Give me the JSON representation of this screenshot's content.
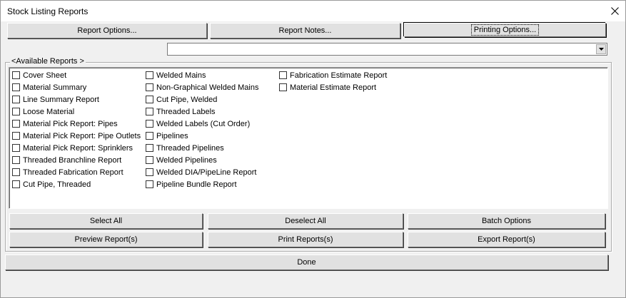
{
  "window": {
    "title": "Stock Listing Reports",
    "close_glyph": "close-icon"
  },
  "top_buttons": {
    "report_options": "Report Options...",
    "report_notes": "Report Notes...",
    "printing_options": "Printing Options..."
  },
  "combo": {
    "value": ""
  },
  "group": {
    "legend": "<Available Reports >"
  },
  "reports": {
    "col1": [
      {
        "label": "Cover Sheet",
        "checked": false
      },
      {
        "label": "Material Summary",
        "checked": false
      },
      {
        "label": "Line Summary Report",
        "checked": false
      },
      {
        "label": "Loose Material",
        "checked": false
      },
      {
        "label": "Material Pick Report: Pipes",
        "checked": false
      },
      {
        "label": "Material Pick Report: Pipe Outlets",
        "checked": false
      },
      {
        "label": "Material Pick Report: Sprinklers",
        "checked": false
      },
      {
        "label": "Threaded Branchline Report",
        "checked": false
      },
      {
        "label": "Threaded Fabrication Report",
        "checked": false
      },
      {
        "label": "Cut Pipe, Threaded",
        "checked": false
      }
    ],
    "col2": [
      {
        "label": "Welded Mains",
        "checked": false
      },
      {
        "label": "Non-Graphical Welded Mains",
        "checked": false
      },
      {
        "label": "Cut Pipe, Welded",
        "checked": false
      },
      {
        "label": "Threaded Labels",
        "checked": false
      },
      {
        "label": "Welded Labels (Cut Order)",
        "checked": false
      },
      {
        "label": "Pipelines",
        "checked": false
      },
      {
        "label": "Threaded Pipelines",
        "checked": false
      },
      {
        "label": "Welded Pipelines",
        "checked": false
      },
      {
        "label": "Welded DIA/PipeLine Report",
        "checked": false
      },
      {
        "label": "Pipeline Bundle Report",
        "checked": false
      }
    ],
    "col3": [
      {
        "label": "Fabrication Estimate Report",
        "checked": false
      },
      {
        "label": "Material Estimate Report",
        "checked": false
      }
    ]
  },
  "bottom_buttons": {
    "select_all": "Select All",
    "deselect_all": "Deselect All",
    "batch_options": "Batch Options",
    "preview_reports": "Preview Report(s)",
    "print_reports": "Print Reports(s)",
    "export_reports": "Export Report(s)",
    "done": "Done"
  }
}
